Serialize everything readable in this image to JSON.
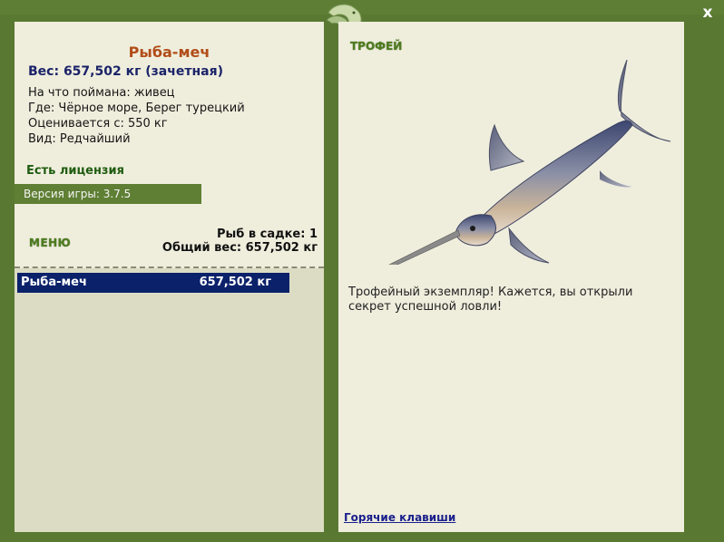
{
  "header": {
    "close_label": "x",
    "logo_icon": "green-fish-logo-icon"
  },
  "fish": {
    "title": "Рыба-меч",
    "weight_line": "Вес: 657,502 кг (зачетная)",
    "info": [
      "На что поймана: живец",
      "Где: Чёрное море, Берег турецкий",
      "Оценивается с: 550 кг",
      "Вид: Редчайший"
    ]
  },
  "license": "Есть лицензия",
  "version": "Версия игры: 3.7.5",
  "menu_label": "МЕНЮ",
  "cage": {
    "count_line": "Рыб в садке: 1",
    "total_line": "Общий вес: 657,502 кг"
  },
  "catch_list": [
    {
      "name": "Рыба-меч",
      "weight": "657,502 кг"
    }
  ],
  "trophy": {
    "label": "ТРОФЕЙ",
    "text": "Трофейный экземпляр! Кажется, вы открыли секрет успешной ловли!",
    "image_icon": "swordfish-image"
  },
  "hotkeys_label": "Горячие клавиши",
  "colors": {
    "frame": "#597932",
    "panel": "#efeedd",
    "title": "#b24d19",
    "weight": "#1b2369",
    "license": "#1f5c10",
    "selected_row": "#0b216a",
    "link": "#1a1f8c"
  }
}
